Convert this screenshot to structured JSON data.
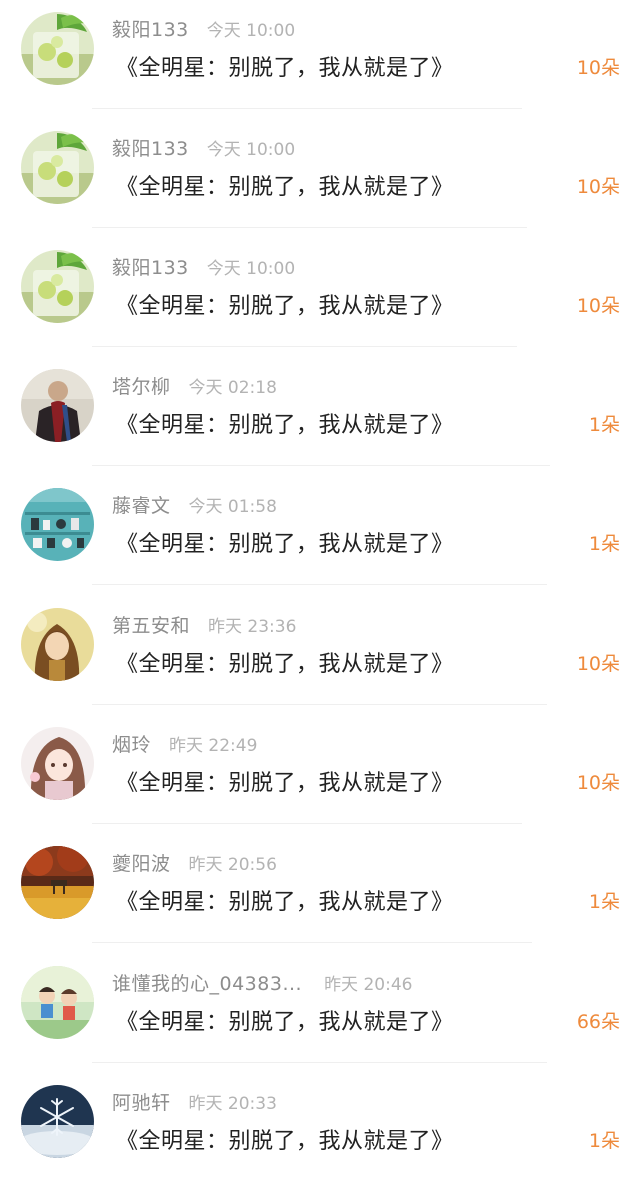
{
  "colors": {
    "username": "#8d8d8d",
    "time": "#b3b3b3",
    "title": "#222222",
    "gift": "#ee8a3c",
    "divider": "#efefef"
  },
  "items": [
    {
      "user": "毅阳133",
      "time": "今天 10:00",
      "title": "《全明星：别脱了，我从就是了》",
      "gift": "10朵",
      "avatar": "lime-drink-avatar"
    },
    {
      "user": "毅阳133",
      "time": "今天 10:00",
      "title": "《全明星：别脱了，我从就是了》",
      "gift": "10朵",
      "avatar": "lime-drink-avatar"
    },
    {
      "user": "毅阳133",
      "time": "今天 10:00",
      "title": "《全明星：别脱了，我从就是了》",
      "gift": "10朵",
      "avatar": "lime-drink-avatar"
    },
    {
      "user": "塔尔柳",
      "time": "今天 02:18",
      "title": "《全明星：别脱了，我从就是了》",
      "gift": "1朵",
      "avatar": "man-scarf-avatar"
    },
    {
      "user": "藤睿文",
      "time": "今天 01:58",
      "title": "《全明星：别脱了，我从就是了》",
      "gift": "1朵",
      "avatar": "teal-shelf-avatar"
    },
    {
      "user": "第五安和",
      "time": "昨天 23:36",
      "title": "《全明星：别脱了，我从就是了》",
      "gift": "10朵",
      "avatar": "anime-girl-yellow-avatar"
    },
    {
      "user": "烟玲",
      "time": "昨天 22:49",
      "title": "《全明星：别脱了，我从就是了》",
      "gift": "10朵",
      "avatar": "anime-girl-pink-avatar"
    },
    {
      "user": "夔阳波",
      "time": "昨天 20:56",
      "title": "《全明星：别脱了，我从就是了》",
      "gift": "1朵",
      "avatar": "autumn-field-avatar"
    },
    {
      "user": "谁懂我的心_04383...",
      "time": "昨天 20:46",
      "title": "《全明星：别脱了，我从就是了》",
      "gift": "66朵",
      "avatar": "cartoon-kids-avatar"
    },
    {
      "user": "阿驰轩",
      "time": "昨天 20:33",
      "title": "《全明星：别脱了，我从就是了》",
      "gift": "1朵",
      "avatar": "snowflake-avatar"
    }
  ]
}
